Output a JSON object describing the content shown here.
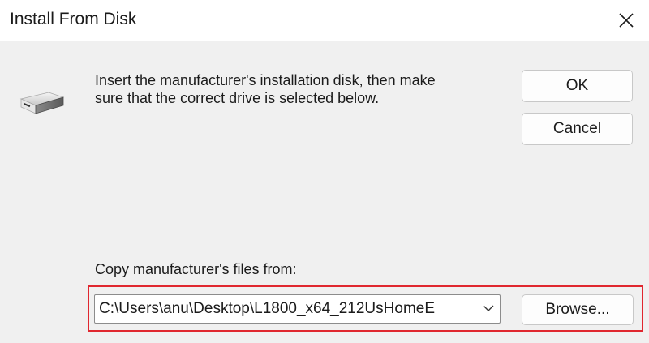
{
  "window": {
    "title": "Install From Disk",
    "close_icon": "close-icon"
  },
  "body": {
    "drive_icon": "disk-drive-icon",
    "message_line1": "Insert the manufacturer's installation disk, then make",
    "message_line2": "sure that the correct drive is selected below."
  },
  "buttons": {
    "ok_label": "OK",
    "cancel_label": "Cancel",
    "browse_label": "Browse..."
  },
  "copy_from": {
    "label": "Copy manufacturer's files from:",
    "value": "C:\\Users\\anu\\Desktop\\L1800_x64_212UsHomeE",
    "dropdown_icon": "chevron-down-icon"
  },
  "colors": {
    "highlight": "#e0272f",
    "dialog_bg": "#f0f0f0",
    "title_bg": "#ffffff"
  }
}
